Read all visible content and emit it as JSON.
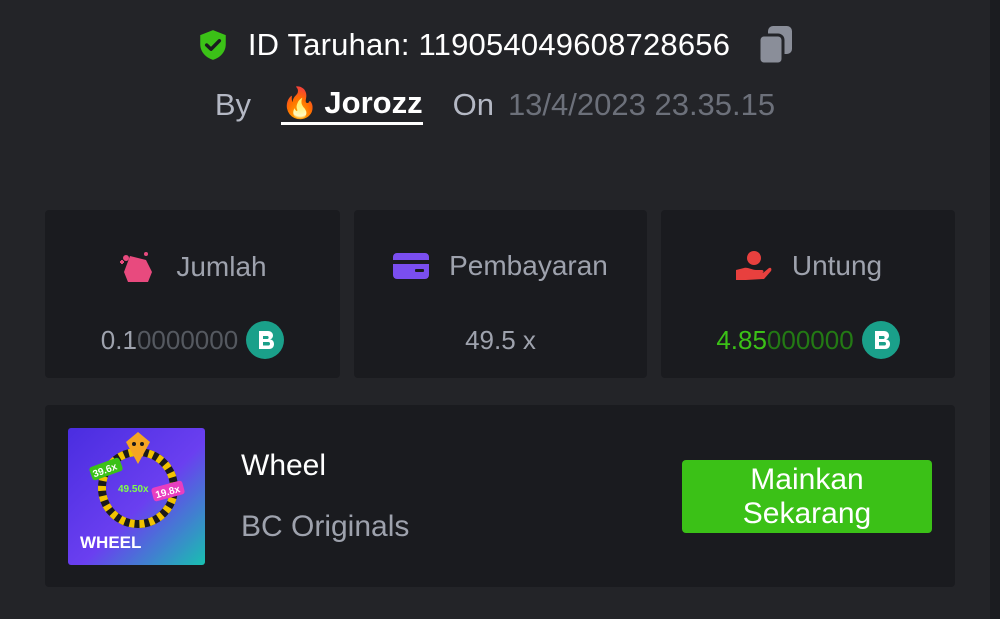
{
  "header": {
    "bet_id_label": "ID Taruhan: 119054049608728656",
    "by_label": "By",
    "username": "Jorozz",
    "on_label": "On",
    "datetime": "13/4/2023 23.35.15"
  },
  "stats": {
    "amount": {
      "label": "Jumlah",
      "value_main": "0.1",
      "value_dim": "0000000"
    },
    "payout": {
      "label": "Pembayaran",
      "value": "49.5 x"
    },
    "profit": {
      "label": "Untung",
      "value_main": "4.85",
      "value_dim": "000000"
    }
  },
  "game": {
    "title": "Wheel",
    "provider": "BC Originals",
    "thumbnail_text": "WHEEL",
    "thumb_badges": [
      "39.6x",
      "49.50x",
      "19.8x"
    ],
    "play_label": "Mainkan Sekarang"
  },
  "colors": {
    "background": "#232428",
    "card": "#1a1b1f",
    "accent_green": "#3bc117",
    "shield_green": "#3bc117",
    "coin_teal": "#1aa08a",
    "amount_icon": "#e84a7e",
    "payout_icon": "#7a4ef0",
    "profit_icon": "#e8403e"
  },
  "icons": [
    "verified-shield-icon",
    "copy-icon",
    "fire-icon",
    "bet-amount-icon",
    "card-icon",
    "profit-hand-icon",
    "bc-coin-icon"
  ]
}
